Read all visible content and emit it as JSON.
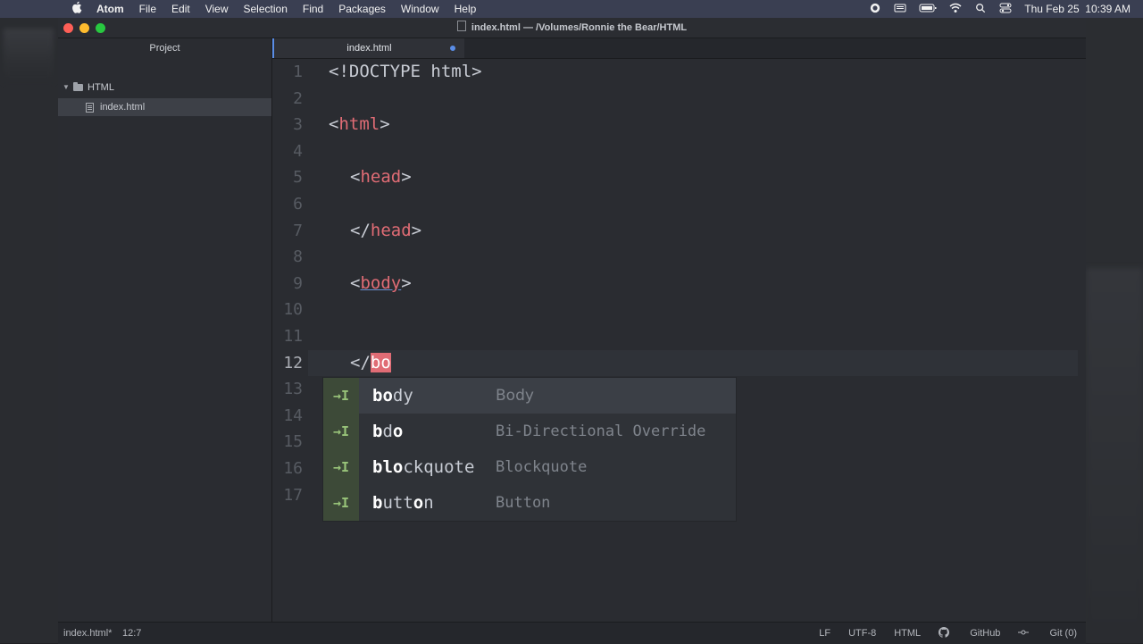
{
  "menubar": {
    "app_name": "Atom",
    "items": [
      "File",
      "Edit",
      "View",
      "Selection",
      "Find",
      "Packages",
      "Window",
      "Help"
    ],
    "datetime": "Thu Feb 25  10:39 AM"
  },
  "window": {
    "title": "index.html — /Volumes/Ronnie the Bear/HTML"
  },
  "sidebar": {
    "header": "Project",
    "folder": "HTML",
    "file": "index.html"
  },
  "tab": {
    "label": "index.html"
  },
  "editor": {
    "line_numbers": [
      "1",
      "2",
      "3",
      "4",
      "5",
      "6",
      "7",
      "8",
      "9",
      "10",
      "11",
      "12",
      "13",
      "14",
      "15",
      "16",
      "17"
    ],
    "current_line": 12,
    "lines": {
      "l1": "<!DOCTYPE html>",
      "l3_open": "<",
      "l3_tag": "html",
      "l3_close": ">",
      "l5_open": "<",
      "l5_tag": "head",
      "l5_close": ">",
      "l7_open": "</",
      "l7_tag": "head",
      "l7_close": ">",
      "l9_open": "<",
      "l9_tag": "body",
      "l9_close": ">",
      "l12_open": "</",
      "l12_typed": "bo"
    }
  },
  "autocomplete": {
    "icon": "→I",
    "items": [
      {
        "typed": "bo",
        "rest": "dy",
        "description": "Body"
      },
      {
        "typed": "b",
        "mid": "d",
        "typed2": "o",
        "rest": "",
        "description": "Bi-Directional Override"
      },
      {
        "typed": "bl",
        "mid": "",
        "typed2": "o",
        "rest": "ckquote",
        "description": "Blockquote"
      },
      {
        "typed": "b",
        "mid": "utt",
        "typed2": "o",
        "rest": "n",
        "description": "Button"
      }
    ]
  },
  "statusbar": {
    "file": "index.html*",
    "cursor": "12:7",
    "line_ending": "LF",
    "encoding": "UTF-8",
    "grammar": "HTML",
    "github": "GitHub",
    "git": "Git (0)"
  }
}
